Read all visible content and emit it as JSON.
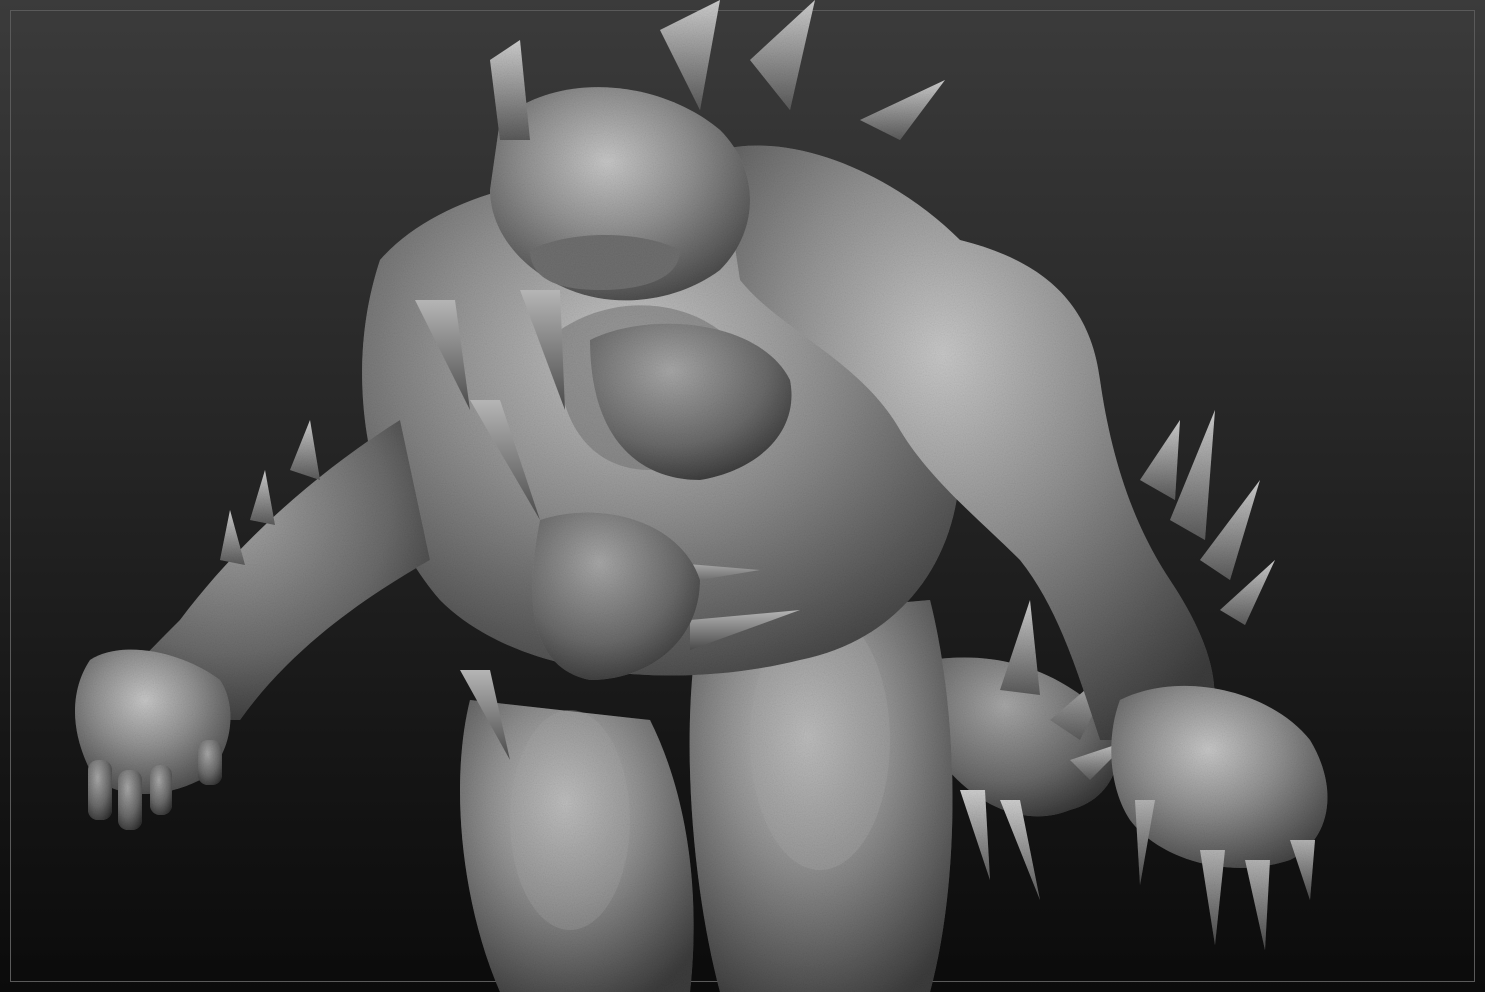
{
  "viewport": {
    "background_top": "#3b3b3b",
    "background_bottom": "#0b0b0b",
    "frame_color": "#5a5a5a"
  },
  "sculpt": {
    "subject": "monster-creature-sculpt",
    "material_base": "#8e8e8e",
    "material_highlight": "#c4c4c4",
    "material_shadow": "#3a3a3a"
  }
}
